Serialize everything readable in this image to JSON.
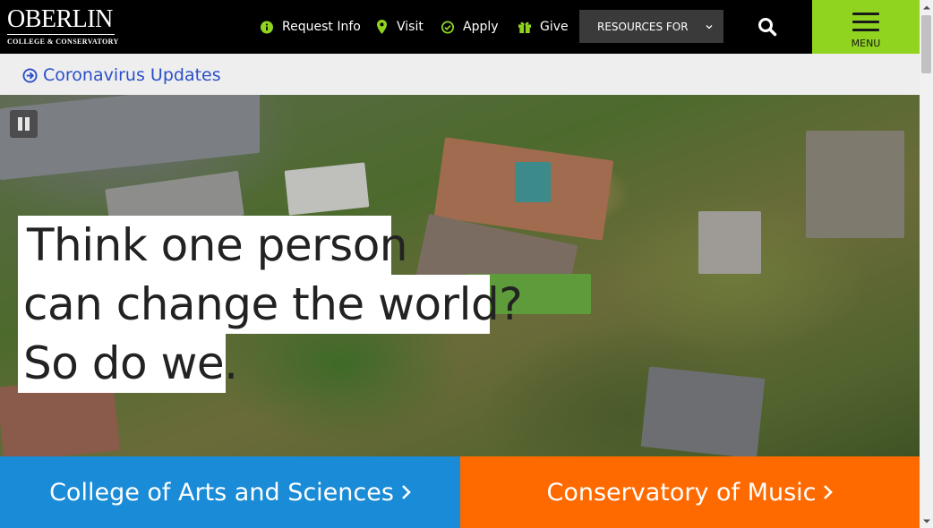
{
  "header": {
    "logo_name": "OBERLIN",
    "logo_tagline": "COLLEGE & CONSERVATORY",
    "nav": [
      {
        "label": "Request Info",
        "icon": "info-circle-icon"
      },
      {
        "label": "Visit",
        "icon": "map-pin-icon"
      },
      {
        "label": "Apply",
        "icon": "check-circle-icon"
      },
      {
        "label": "Give",
        "icon": "gift-icon"
      }
    ],
    "resources_label": "RESOURCES FOR",
    "search_icon": "search-icon",
    "menu_label": "MENU"
  },
  "alert": {
    "label": "Coronavirus Updates",
    "icon": "arrow-circle-right-icon"
  },
  "hero": {
    "headline_lines": [
      "Think one person",
      "can change the world?",
      "So do we."
    ],
    "pause_icon": "pause-icon"
  },
  "panels": [
    {
      "label": "College of Arts and Sciences",
      "color": "#1a8bd6"
    },
    {
      "label": "Conservatory of Music",
      "color": "#ff6a00"
    }
  ],
  "colors": {
    "header_bg": "#000000",
    "menu_bg": "#90d41f",
    "alert_bg": "#eeeeee",
    "alert_link": "#2b4fc9",
    "nav_icon": "#90d41f"
  }
}
